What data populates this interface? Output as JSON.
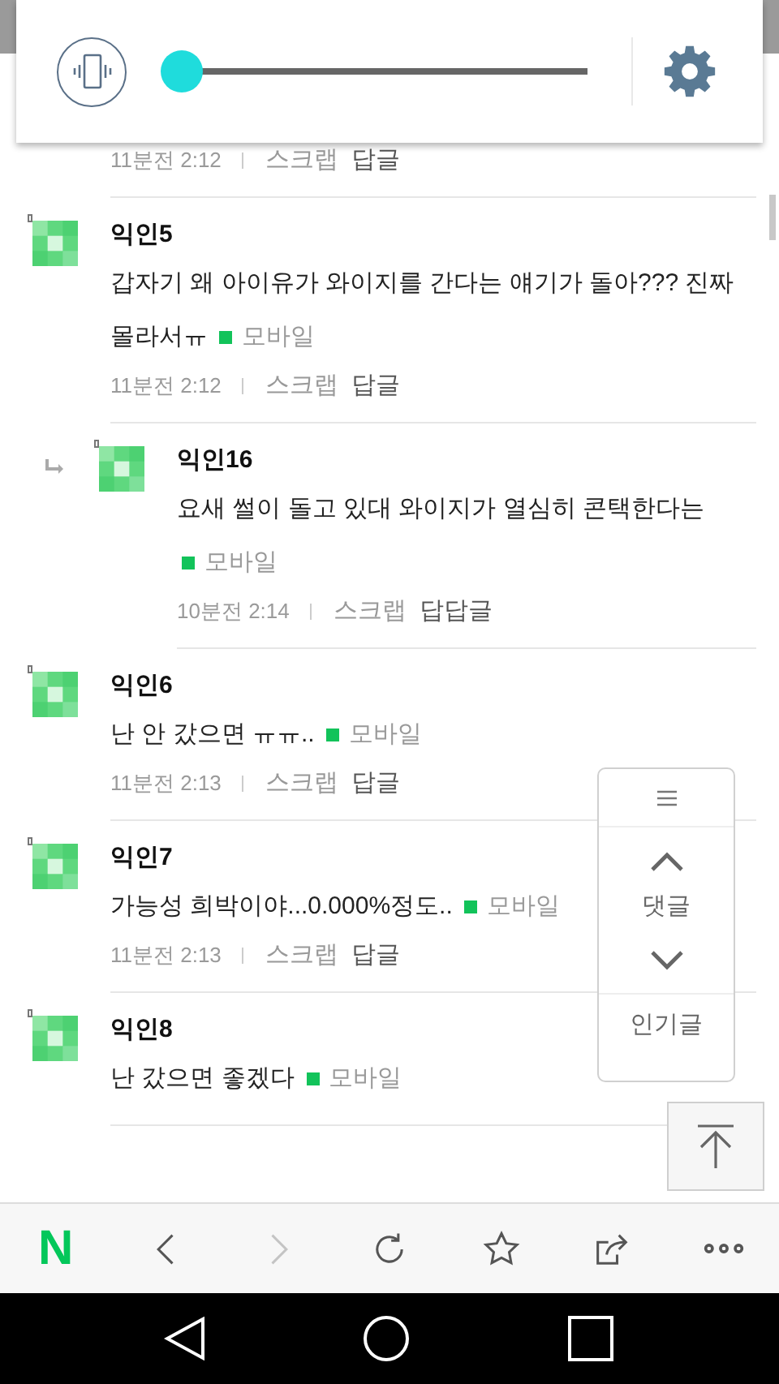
{
  "volume_popup": {
    "level": 0
  },
  "comments": [
    {
      "kind": "comment",
      "time": "11분전 2:12",
      "scrap": "스크랩",
      "reply": "답글"
    },
    {
      "kind": "comment",
      "name": "익인5",
      "text": "갑자기 왜 아이유가 와이지를 간다는 얘기가 돌아??? 진짜 몰라서ㅠ",
      "source": "모바일",
      "time": "11분전 2:12",
      "scrap": "스크랩",
      "reply": "답글"
    },
    {
      "kind": "reply",
      "name": "익인16",
      "text": "요새 썰이 돌고 있대 와이지가 열심히 콘택한다는",
      "source": "모바일",
      "time": "10분전 2:14",
      "scrap": "스크랩",
      "reply": "답답글"
    },
    {
      "kind": "comment",
      "name": "익인6",
      "text": "난 안 갔으면 ㅠㅠ..",
      "source": "모바일",
      "time": "11분전 2:13",
      "scrap": "스크랩",
      "reply": "답글"
    },
    {
      "kind": "comment",
      "name": "익인7",
      "text": "가능성 희박이야...0.000%정도..",
      "source": "모바일",
      "time": "11분전 2:13",
      "scrap": "스크랩",
      "reply": "답글"
    },
    {
      "kind": "comment",
      "name": "익인8",
      "text": "난 갔으면 좋겠다",
      "source": "모바일"
    }
  ],
  "float_nav": {
    "label": "댓글",
    "popular": "인기글"
  },
  "toolbar": {
    "logo": "N",
    "buttons": [
      {
        "kind": "back",
        "disabled": false
      },
      {
        "kind": "forward",
        "disabled": true
      },
      {
        "kind": "refresh",
        "disabled": false
      },
      {
        "kind": "bookmark",
        "disabled": false
      },
      {
        "kind": "share",
        "disabled": false
      },
      {
        "kind": "more",
        "disabled": false
      }
    ]
  }
}
